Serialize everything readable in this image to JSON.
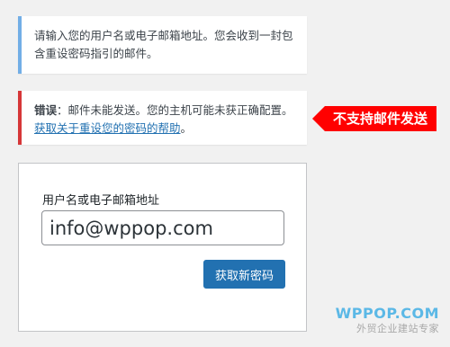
{
  "info_notice": {
    "text": "请输入您的用户名或电子邮箱地址。您会收到一封包含重设密码指引的邮件。"
  },
  "error_notice": {
    "label": "错误",
    "message": "：邮件未能发送。您的主机可能未获正确配置。",
    "link_text": "获取关于重设您的密码的帮助",
    "suffix": "。"
  },
  "annotation": {
    "text": "不支持邮件发送",
    "color": "#ff0000"
  },
  "form": {
    "field_label": "用户名或电子邮箱地址",
    "field_value": "info@wppop.com",
    "submit_label": "获取新密码"
  },
  "watermark": {
    "brand": "WPPOP.COM",
    "tagline": "外贸企业建站专家"
  },
  "colors": {
    "info_border": "#72aee6",
    "error_border": "#d63638",
    "button": "#2271b1",
    "link": "#2271b1"
  }
}
